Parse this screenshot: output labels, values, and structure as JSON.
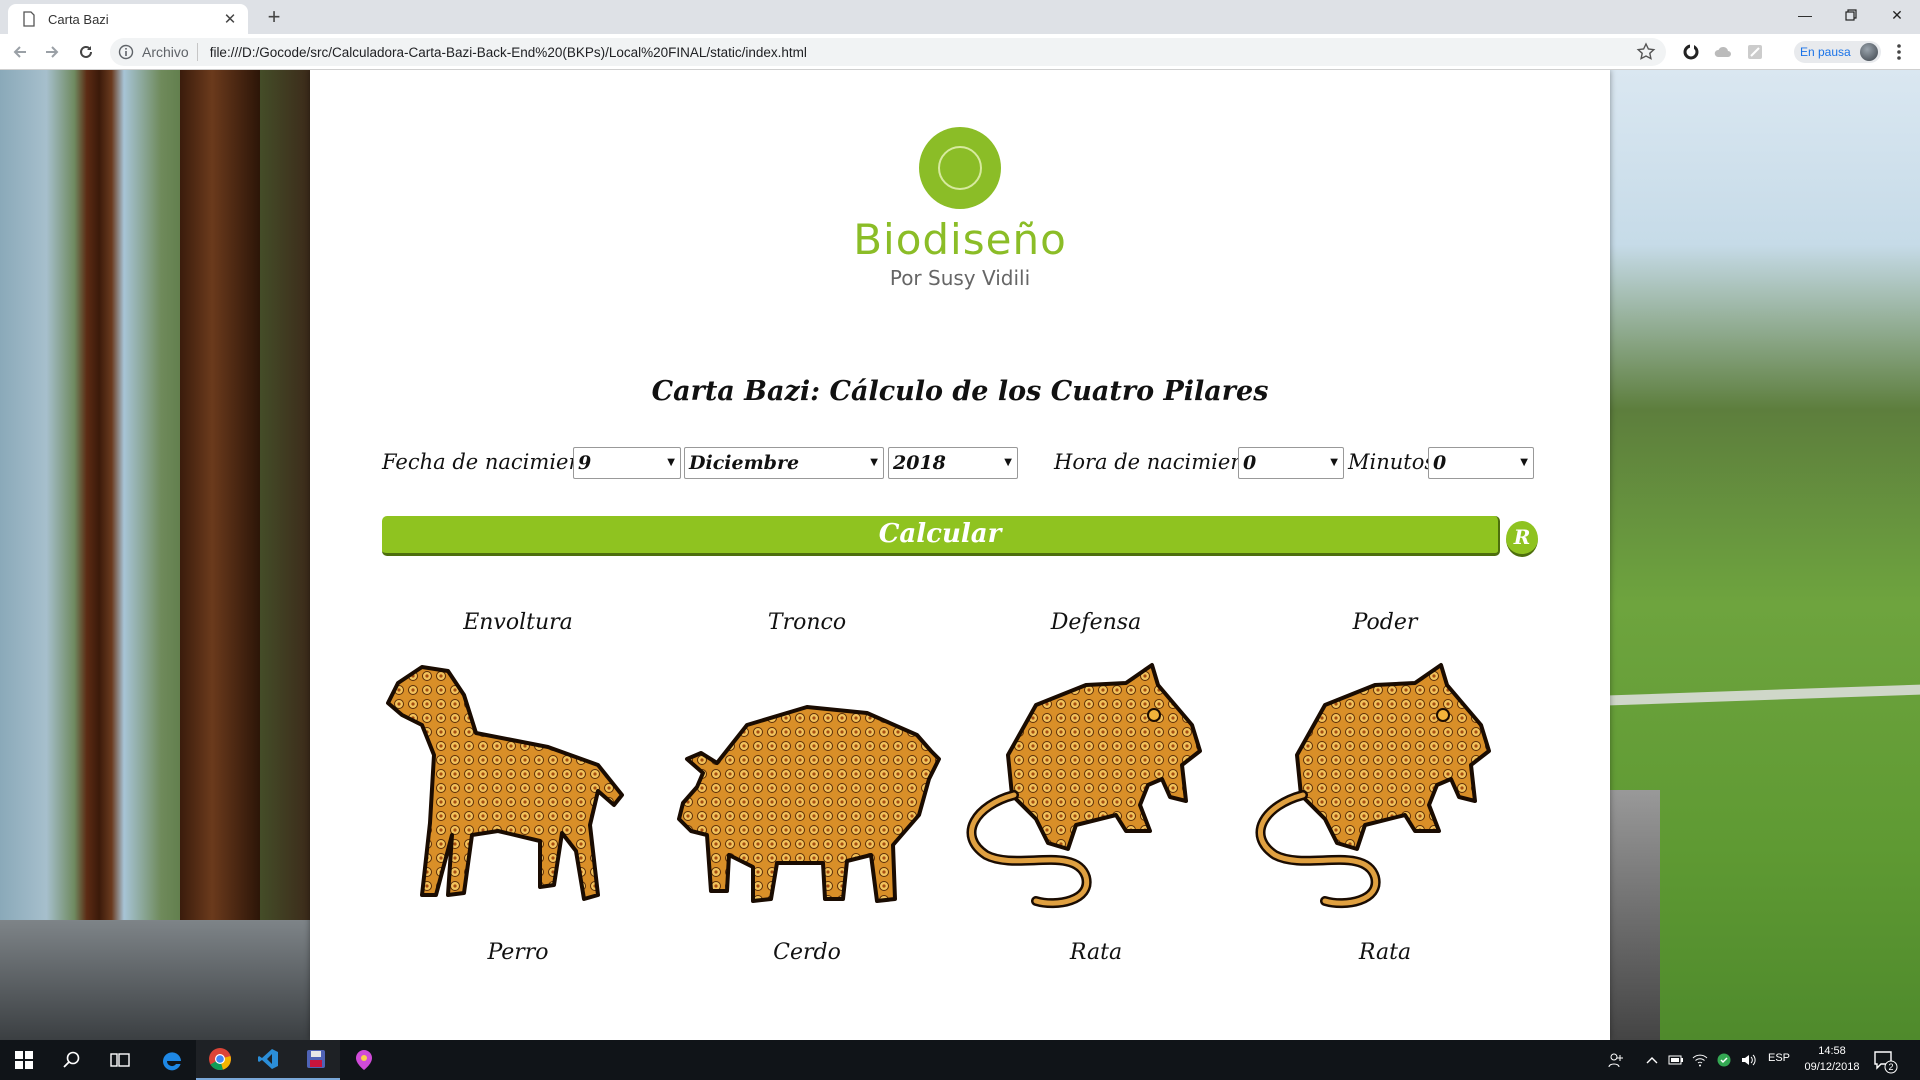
{
  "browser": {
    "tab_title": "Carta Bazi",
    "scheme_label": "Archivo",
    "url": "file:///D:/Gocode/src/Calculadora-Carta-Bazi-Back-End%20(BKPs)/Local%20FINAL/static/index.html",
    "profile_status": "En pausa"
  },
  "brand": {
    "name": "Biodiseño",
    "tagline": "Por Susy Vidili",
    "color": "#8bbd27"
  },
  "form": {
    "heading": "Carta Bazi:  Cálculo de los Cuatro Pilares",
    "birth_date_label": "Fecha de nacimiento:",
    "day": "9",
    "month": "Diciembre",
    "year": "2018",
    "birth_time_label": "Hora de nacimiento:",
    "hour": "0",
    "minutes_label": "Minutos:",
    "minutes": "0",
    "calculate_label": "Calcular",
    "reset_label": "R",
    "button_color": "#8fc320"
  },
  "pillars": [
    {
      "title": "Envoltura",
      "animal": "Perro",
      "icon": "dog-mandala"
    },
    {
      "title": "Tronco",
      "animal": "Cerdo",
      "icon": "pig-mandala"
    },
    {
      "title": "Defensa",
      "animal": "Rata",
      "icon": "rat-mandala"
    },
    {
      "title": "Poder",
      "animal": "Rata",
      "icon": "rat-mandala"
    }
  ],
  "taskbar": {
    "language": "ESP",
    "time": "14:58",
    "date": "09/12/2018",
    "notifications": "2"
  }
}
